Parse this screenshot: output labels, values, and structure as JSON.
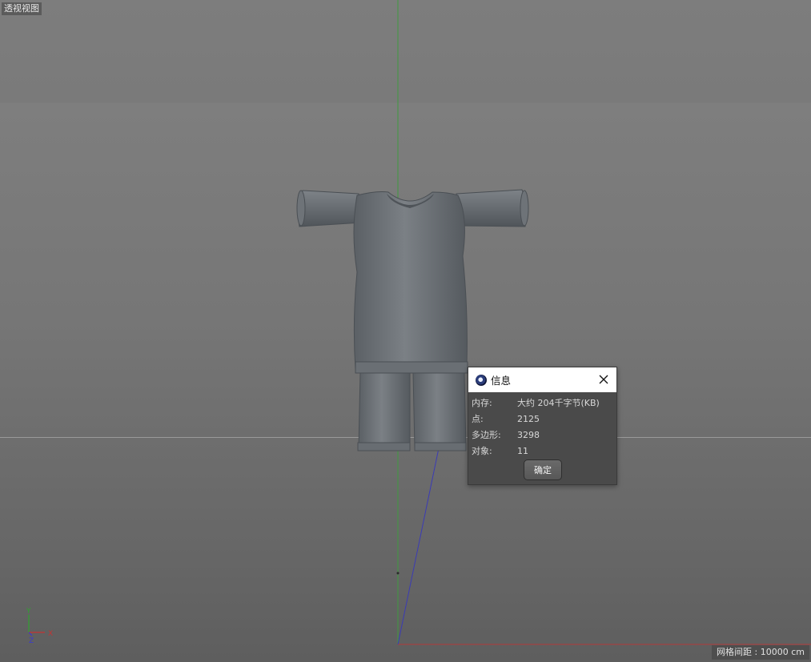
{
  "viewport": {
    "label": "透视视图",
    "grid_spacing": "网格间距 : 10000 cm",
    "axes": {
      "y": "Y",
      "x": "X",
      "z": "Z"
    },
    "colors": {
      "y_axis": "#2fa32f",
      "x_axis": "#c23434",
      "z_axis": "#3a3ad0"
    }
  },
  "dialog": {
    "title": "信息",
    "rows": [
      {
        "key": "内存:",
        "value": "大约 204千字节(KB)"
      },
      {
        "key": "点:",
        "value": "2125"
      },
      {
        "key": "多边形:",
        "value": "3298"
      },
      {
        "key": "对象:",
        "value": "11"
      }
    ],
    "ok_label": "确定",
    "close_icon": "close-icon",
    "app_icon": "cinema4d-icon"
  },
  "model": {
    "name": "clothing-mesh"
  }
}
